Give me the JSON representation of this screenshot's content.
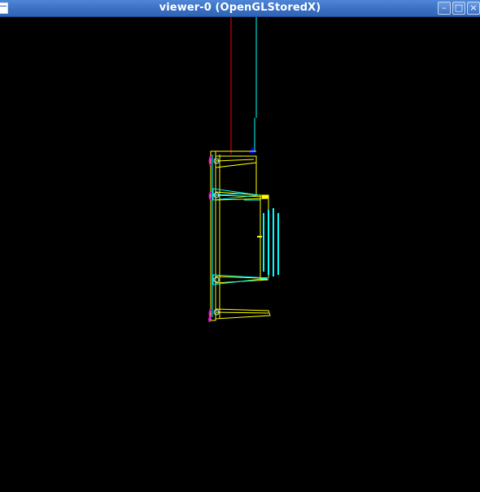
{
  "window": {
    "title": "viewer-0 (OpenGLStoredX)",
    "buttons": {
      "minimize": "–",
      "maximize": "□",
      "close": "×"
    },
    "icons": {
      "menu": "window-menu-icon",
      "minimize": "minimize-icon",
      "maximize": "maximize-icon",
      "close": "close-icon"
    }
  },
  "scene": {
    "background": "#000000",
    "colors": {
      "x_axis": "#ff0000",
      "y_axis": "#00ffff",
      "z_axis": "#0000ff",
      "yellow": "#ffff00",
      "cyan": "#00ffff",
      "magenta": "#ff00ff"
    }
  }
}
